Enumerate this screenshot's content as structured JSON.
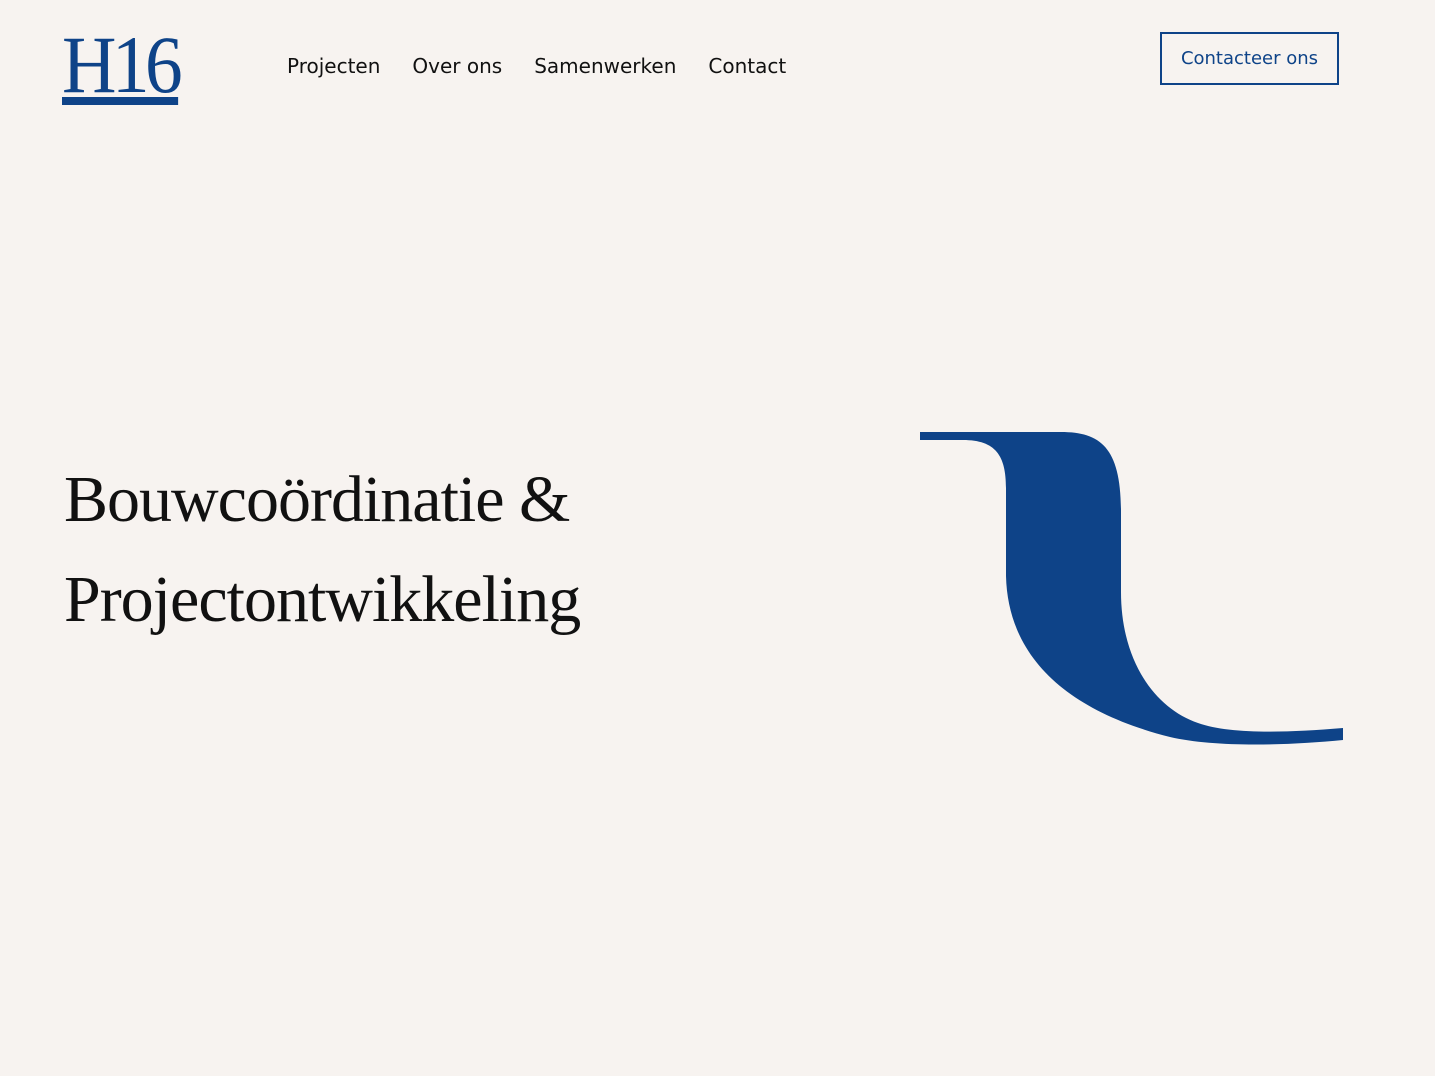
{
  "header": {
    "logo_text": "H16",
    "nav_items": [
      {
        "label": "Projecten"
      },
      {
        "label": "Over ons"
      },
      {
        "label": "Samenwerken"
      },
      {
        "label": "Contact"
      }
    ],
    "cta_label": "Contacteer ons"
  },
  "hero": {
    "title_line_1": "Bouwcoördinatie &",
    "title_line_2": "Projectontwikkeling"
  },
  "colors": {
    "background": "#f7f3f0",
    "brand": "#0e4388",
    "text": "#111111"
  }
}
